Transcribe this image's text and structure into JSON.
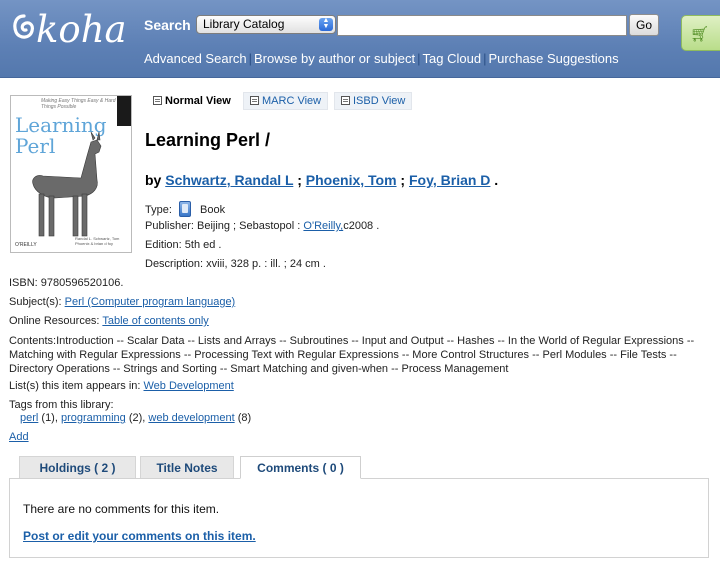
{
  "header": {
    "logo_text": "koha",
    "search_label": "Search",
    "catalog_select": "Library Catalog",
    "search_value": "",
    "go_label": "Go",
    "links": [
      "Advanced Search",
      "Browse by author or subject",
      "Tag Cloud",
      "Purchase Suggestions"
    ]
  },
  "cover": {
    "tagline": "Making Easy Things Easy & Hard Things Possible",
    "title": "Learning Perl",
    "publisher": "O'REILLY",
    "authors": "Randal L. Schwartz, Tom Phoenix & brian d foy"
  },
  "view_tabs": [
    "Normal View",
    "MARC View",
    "ISBD View"
  ],
  "record": {
    "title": "Learning Perl /",
    "by_label": "by",
    "authors": [
      "Schwartz, Randal L",
      "Phoenix, Tom",
      "Foy, Brian D"
    ],
    "type_label": "Type:",
    "type_value": "Book",
    "publisher_label": "Publisher:",
    "publisher_place": "Beijing ; Sebastopol :",
    "publisher_name": "O'Reilly,",
    "publisher_date": "c2008 .",
    "edition_label": "Edition:",
    "edition_value": "5th ed .",
    "description_label": "Description:",
    "description_value": "xviii, 328 p. : ill. ; 24 cm ."
  },
  "details": {
    "isbn_label": "ISBN:",
    "isbn_value": "9780596520106.",
    "subjects_label": "Subject(s):",
    "subject_link": "Perl (Computer program language)",
    "online_label": "Online Resources:",
    "online_link": "Table of contents only",
    "contents_label": "Contents:",
    "contents_text": "Introduction -- Scalar Data -- Lists and Arrays -- Subroutines -- Input and Output -- Hashes -- In the World of Regular Expressions -- Matching with Regular Expressions -- Processing Text with Regular Expressions -- More Control Structures -- Perl Modules -- File Tests -- Directory Operations -- Strings and Sorting -- Smart Matching and given-when -- Process Management",
    "lists_label": "List(s) this item appears in:",
    "lists_link": "Web Development",
    "tags_label": "Tags from this library:",
    "tags": [
      {
        "name": "perl",
        "count": "(1),"
      },
      {
        "name": "programming",
        "count": "(2),"
      },
      {
        "name": "web development",
        "count": "(8)"
      }
    ],
    "add_link": "Add"
  },
  "bottom_tabs": [
    "Holdings ( 2 )",
    "Title Notes",
    "Comments ( 0 )"
  ],
  "comments": {
    "empty_text": "There are no comments for this item.",
    "post_link": "Post or edit your comments on this item."
  },
  "colors": {
    "header_bg": "#5d80b5",
    "link": "#1b5fa8",
    "cart_bg": "#b9dd8a"
  }
}
